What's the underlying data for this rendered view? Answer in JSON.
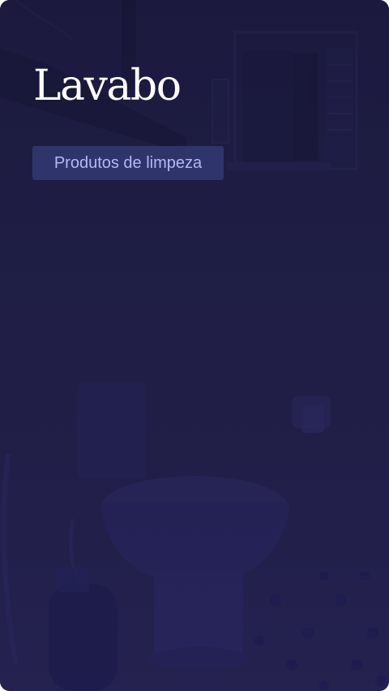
{
  "card": {
    "title": "Lavabo",
    "tag": "Produtos de limpeza"
  },
  "colors": {
    "background": "#1d1c3f",
    "title": "#ffffff",
    "tag_background": "#363f7a",
    "tag_text": "#b4b8f6"
  }
}
